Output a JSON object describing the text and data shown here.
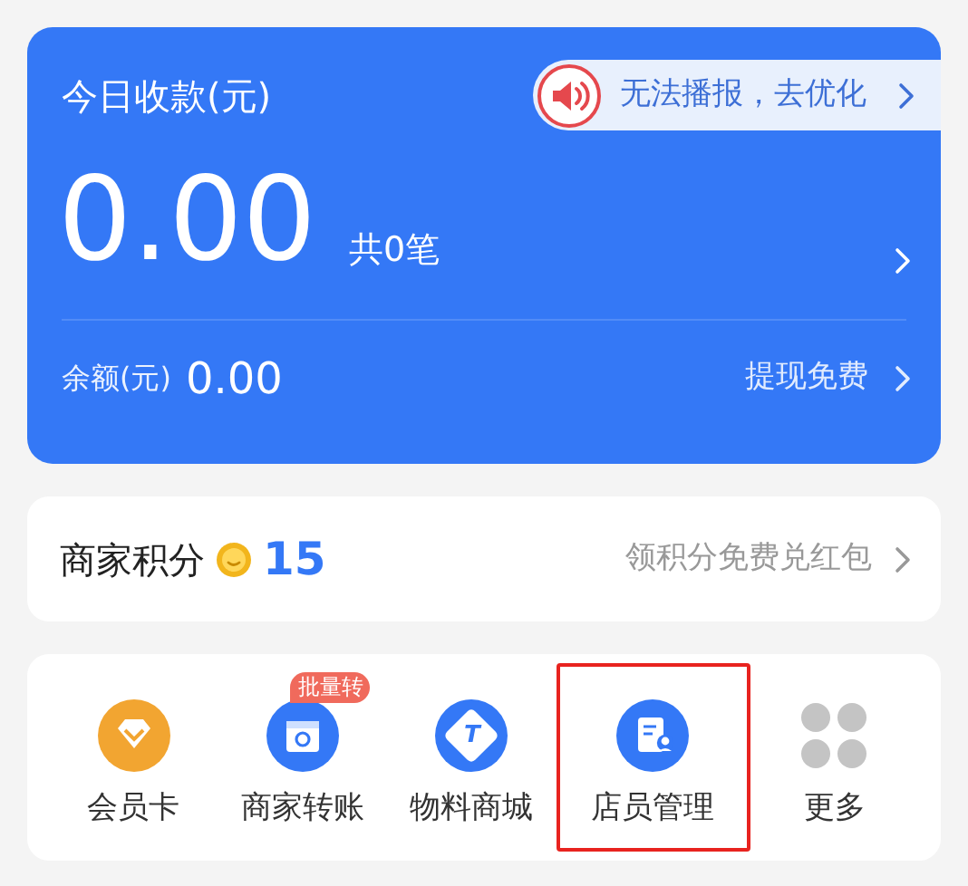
{
  "income_card": {
    "title": "今日收款(元)",
    "notice": "无法播报，去优化",
    "amount": "0.00",
    "count": "共0笔",
    "balance_label": "余额(元)",
    "balance": "0.00",
    "withdraw": "提现免费"
  },
  "points_card": {
    "label": "商家积分",
    "points": "15",
    "promo": "领积分免费兑红包"
  },
  "shortcuts": [
    {
      "kind": "member",
      "label": "会员卡",
      "highlighted": false
    },
    {
      "kind": "transfer",
      "label": "商家转账",
      "badge": "批量转",
      "highlighted": false
    },
    {
      "kind": "mall",
      "label": "物料商城",
      "icon_glyph": "T",
      "highlighted": false
    },
    {
      "kind": "staff",
      "label": "店员管理",
      "highlighted": true
    },
    {
      "kind": "more",
      "label": "更多",
      "highlighted": false
    }
  ]
}
